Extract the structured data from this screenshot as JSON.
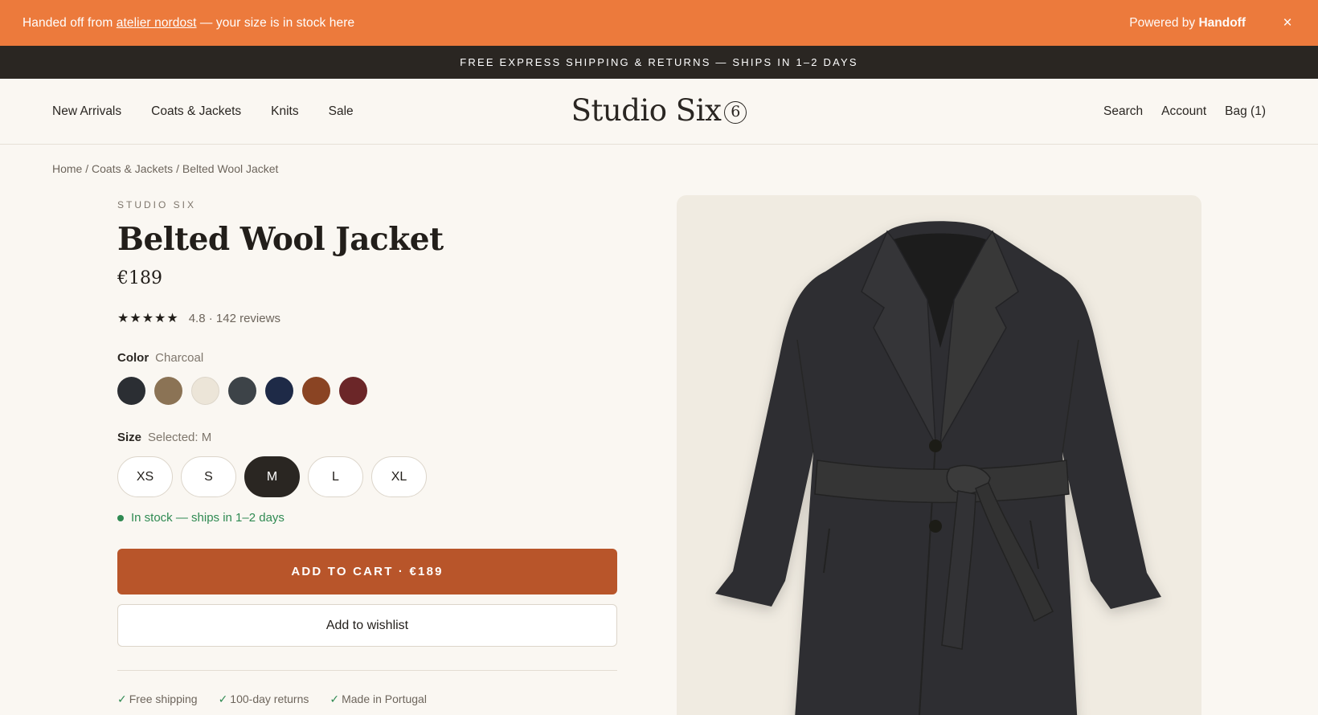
{
  "handoff": {
    "prefix": "Handed off from ",
    "source_link": "atelier nordost",
    "suffix": " — your size is in stock here",
    "powered_prefix": "Powered by ",
    "powered_brand": "Handoff",
    "close": "×"
  },
  "shipping_banner": "FREE EXPRESS SHIPPING & RETURNS — SHIPS IN 1–2 DAYS",
  "nav": {
    "left": [
      "New Arrivals",
      "Coats & Jackets",
      "Knits",
      "Sale"
    ],
    "logo": "Studio Six",
    "logo_mark": "6",
    "right": [
      "Search",
      "Account",
      "Bag (1)"
    ]
  },
  "breadcrumb": [
    "Home",
    "Coats & Jackets",
    "Belted Wool Jacket"
  ],
  "product": {
    "brand": "STUDIO SIX",
    "title": "Belted Wool Jacket",
    "price": "€189",
    "stars": "★★★★★",
    "rating_text": "4.8 · 142 reviews",
    "color_label": "Color",
    "color_value": "Charcoal",
    "colors": [
      "#2b2e33",
      "#8b7355",
      "#ece5d8",
      "#3d4348",
      "#1e2a47",
      "#8a4423",
      "#6b2628"
    ],
    "size_label": "Size",
    "size_value": "Selected: M",
    "sizes": [
      "XS",
      "S",
      "M",
      "L",
      "XL"
    ],
    "selected_size": "M",
    "stock": "In stock — ships in 1–2 days",
    "add_to_cart": "ADD TO CART · €189",
    "wishlist": "Add to wishlist",
    "perks": [
      "Free shipping",
      "100-day returns",
      "Made in Portugal"
    ]
  },
  "colors": {
    "handoff_bar": "#ec7a3c",
    "ship_bar": "#2a2622",
    "cta": "#b8552a",
    "stock": "#2f8a52",
    "coat": "#2f2f30"
  }
}
